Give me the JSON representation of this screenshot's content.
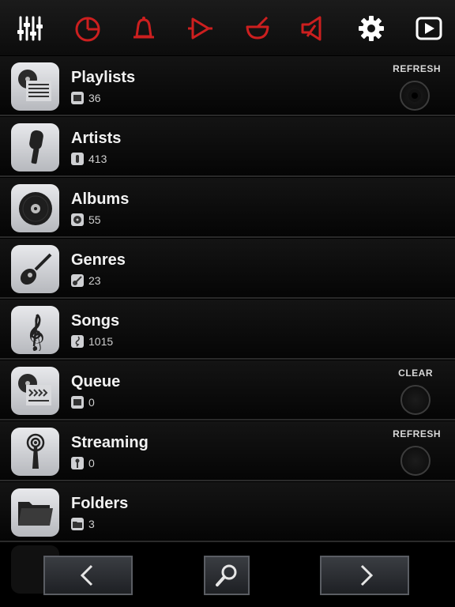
{
  "toolbar": {
    "icons": [
      "mixer-sliders-icon",
      "clock-pie-icon",
      "bell-icon",
      "play-outline-icon",
      "bowl-icon",
      "speaker-icon",
      "gear-icon",
      "play-box-icon"
    ],
    "colors": {
      "white": "#ffffff",
      "red": "#cc1f1f"
    }
  },
  "library": {
    "items": [
      {
        "title": "Playlists",
        "count": "36",
        "action": "REFRESH"
      },
      {
        "title": "Artists",
        "count": "413",
        "action": ""
      },
      {
        "title": "Albums",
        "count": "55",
        "action": ""
      },
      {
        "title": "Genres",
        "count": "23",
        "action": ""
      },
      {
        "title": "Songs",
        "count": "1015",
        "action": ""
      },
      {
        "title": "Queue",
        "count": "0",
        "action": "CLEAR"
      },
      {
        "title": "Streaming",
        "count": "0",
        "action": "REFRESH"
      },
      {
        "title": "Folders",
        "count": "3",
        "action": ""
      }
    ]
  },
  "bottom_nav": {
    "icons": [
      "chevron-left-icon",
      "search-icon",
      "chevron-right-icon"
    ]
  }
}
